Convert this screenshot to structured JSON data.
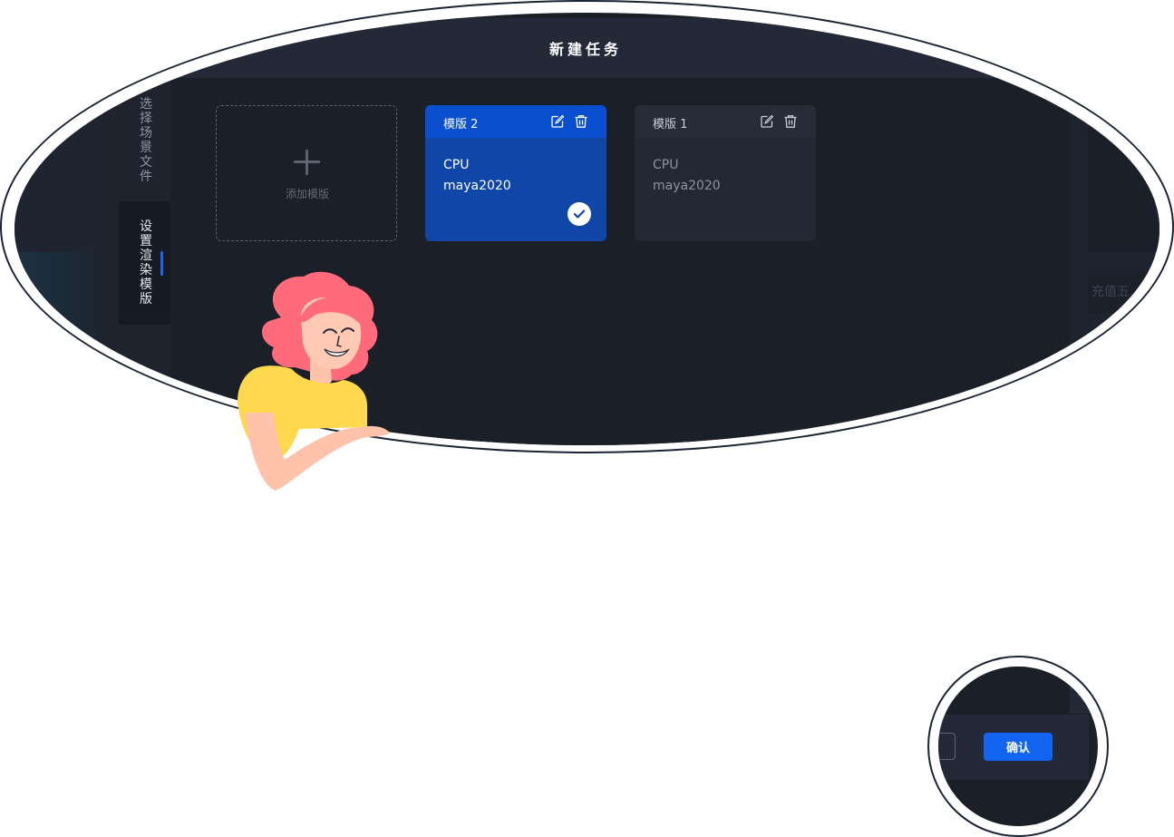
{
  "modal": {
    "title": "新建任务"
  },
  "side_nav": {
    "items": [
      {
        "label": [
          "选",
          "择",
          "场",
          "景",
          "文",
          "件"
        ],
        "active": false
      },
      {
        "label": [
          "设",
          "置",
          "渲",
          "染",
          "模",
          "版"
        ],
        "active": true
      }
    ]
  },
  "templates": {
    "add_label": "添加模版",
    "cards": [
      {
        "name": "模版 2",
        "line1": "CPU",
        "line2": "maya2020",
        "selected": true
      },
      {
        "name": "模版 1",
        "line1": "CPU",
        "line2": "maya2020",
        "selected": false
      }
    ],
    "edit_icon": "edit-icon",
    "delete_icon": "trash-icon",
    "check_icon": "check-icon"
  },
  "background": {
    "right_panel_text": "充值五"
  },
  "footer": {
    "confirm_label": "确认"
  },
  "colors": {
    "accent": "#1265f0",
    "selected_card": "#0f46a8",
    "modal_bg": "#1b1f28"
  }
}
